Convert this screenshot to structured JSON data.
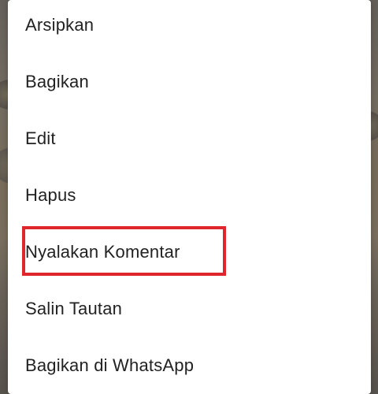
{
  "menu": {
    "items": [
      {
        "label": "Arsipkan"
      },
      {
        "label": "Bagikan"
      },
      {
        "label": "Edit"
      },
      {
        "label": "Hapus"
      },
      {
        "label": "Nyalakan Komentar"
      },
      {
        "label": "Salin Tautan"
      },
      {
        "label": "Bagikan di WhatsApp"
      }
    ]
  },
  "colors": {
    "highlight": "#e0262d",
    "menu_background": "#ffffff",
    "text": "#222222"
  }
}
